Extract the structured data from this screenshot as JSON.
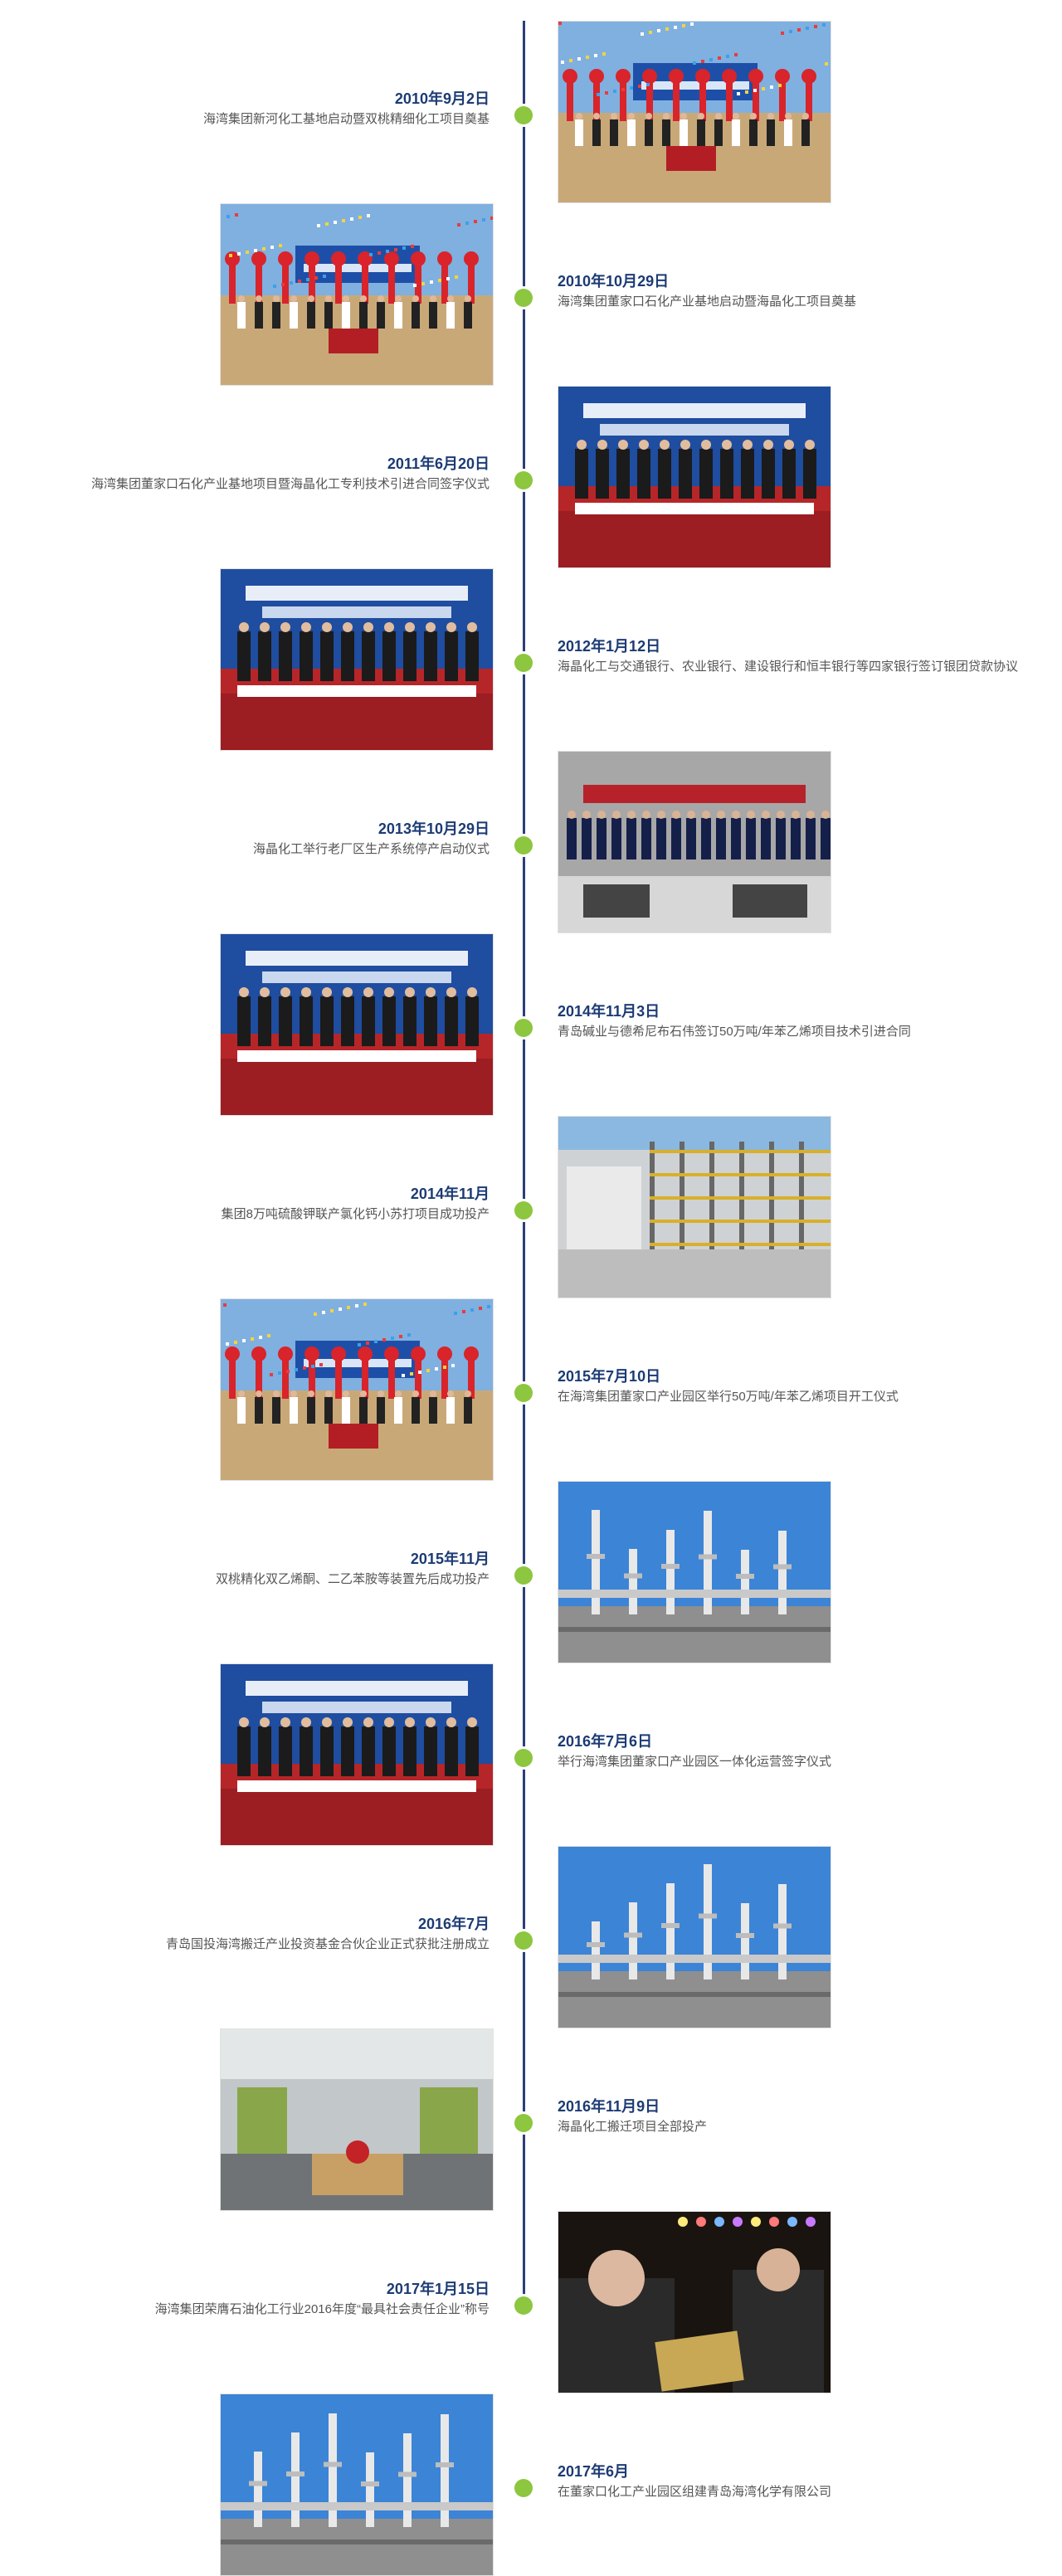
{
  "timeline": {
    "events": [
      {
        "date": "2010年9月2日",
        "desc": "海湾集团新河化工基地启动暨双桃精细化工项目奠基",
        "photo": "groundbreaking-ceremony-photo"
      },
      {
        "date": "2010年10月29日",
        "desc": "海湾集团董家口石化产业基地启动暨海晶化工项目奠基",
        "photo": "groundbreaking-ceremony-photo"
      },
      {
        "date": "2011年6月20日",
        "desc": "海湾集团董家口石化产业基地项目暨海晶化工专利技术引进合同签字仪式",
        "photo": "signing-ceremony-photo"
      },
      {
        "date": "2012年1月12日",
        "desc": "海晶化工与交通银行、农业银行、建设银行和恒丰银行等四家银行签订银团贷款协议",
        "photo": "signing-ceremony-photo"
      },
      {
        "date": "2013年10月29日",
        "desc": "海晶化工举行老厂区生产系统停产启动仪式",
        "photo": "meeting-hall-photo"
      },
      {
        "date": "2014年11月3日",
        "desc": "青岛碱业与德希尼布石伟签订50万吨/年苯乙烯项目技术引进合同",
        "photo": "signing-ceremony-photo"
      },
      {
        "date": "2014年11月",
        "desc": "集团8万吨硫酸钾联产氯化钙小苏打项目成功投产",
        "photo": "plant-interior-photo"
      },
      {
        "date": "2015年7月10日",
        "desc": "在海湾集团董家口产业园区举行50万吨/年苯乙烯项目开工仪式",
        "photo": "groundbreaking-ceremony-photo"
      },
      {
        "date": "2015年11月",
        "desc": "双桃精化双乙烯酮、二乙苯胺等装置先后成功投产",
        "photo": "chemical-plant-photo"
      },
      {
        "date": "2016年7月6日",
        "desc": "举行海湾集团董家口产业园区一体化运营签字仪式",
        "photo": "signing-ceremony-photo"
      },
      {
        "date": "2016年7月",
        "desc": "青岛国投海湾搬迁产业投资基金合伙企业正式获批注册成立",
        "photo": "chemical-plant-photo"
      },
      {
        "date": "2016年11月9日",
        "desc": "海晶化工搬迁项目全部投产",
        "photo": "production-line-photo"
      },
      {
        "date": "2017年1月15日",
        "desc": "海湾集团荣膺石油化工行业2016年度“最具社会责任企业”称号",
        "photo": "award-ceremony-photo"
      },
      {
        "date": "2017年6月",
        "desc": "在董家口化工产业园区组建青岛海湾化学有限公司",
        "photo": "chemical-plant-photo"
      }
    ]
  }
}
